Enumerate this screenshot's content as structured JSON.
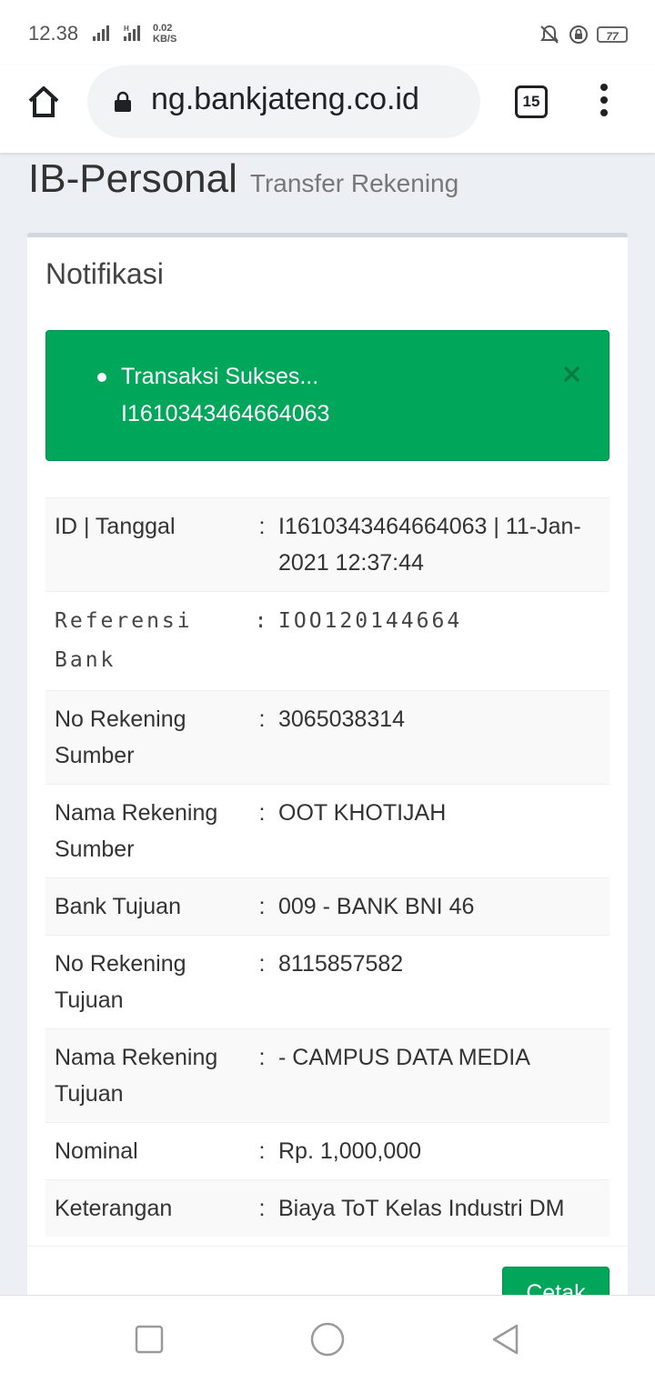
{
  "status_bar": {
    "time": "12.38",
    "net_speed_value": "0.02",
    "net_speed_unit": "KB/S",
    "battery": "77",
    "signal_label": "H"
  },
  "browser": {
    "url": "ng.bankjateng.co.id",
    "tab_count": "15"
  },
  "header": {
    "title": "IB-Personal",
    "subtitle": "Transfer Rekening"
  },
  "box": {
    "title": "Notifikasi"
  },
  "alert": {
    "lines": [
      "Transaksi Sukses...",
      "I1610343464664063"
    ],
    "close": "×"
  },
  "details": [
    {
      "label": "ID | Tanggal",
      "value": "I1610343464664063 | 11-Jan-2021 12:37:44"
    },
    {
      "label": "Referensi Bank",
      "value": "IOO120144664"
    },
    {
      "label": "No Rekening Sumber",
      "value": "3065038314"
    },
    {
      "label": "Nama Rekening Sumber",
      "value": "OOT KHOTIJAH"
    },
    {
      "label": "Bank Tujuan",
      "value": "009 - BANK BNI 46"
    },
    {
      "label": "No Rekening Tujuan",
      "value": "8115857582"
    },
    {
      "label": "Nama Rekening Tujuan",
      "value": "- CAMPUS DATA MEDIA"
    },
    {
      "label": "Nominal",
      "value": "Rp. 1,000,000"
    },
    {
      "label": "Keterangan",
      "value": "Biaya ToT Kelas Industri DM"
    }
  ],
  "separator": ":",
  "print_button": "Cetak",
  "colors": {
    "success": "#00a65a",
    "background": "#ecf0f5"
  }
}
